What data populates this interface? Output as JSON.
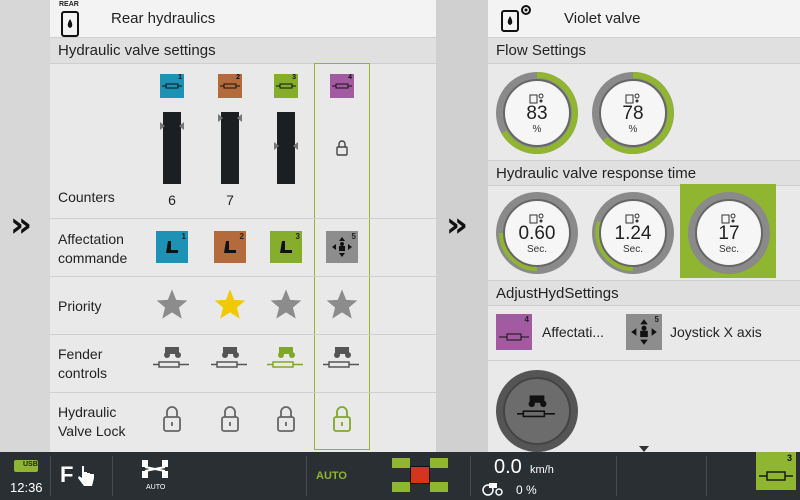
{
  "left_panel": {
    "title": "Rear hydraulics",
    "header_icon_text": "REAR",
    "section_title": "Hydraulic valve settings",
    "valves": [
      {
        "number": "1",
        "color": "#1e92b4",
        "counter": "6",
        "priority_active": false,
        "fender_active": false
      },
      {
        "number": "2",
        "color": "#b56a3c",
        "counter": "7",
        "priority_active": true,
        "fender_active": false
      },
      {
        "number": "3",
        "color": "#86ad2c",
        "counter": "",
        "priority_active": false,
        "fender_active": true
      },
      {
        "number": "4",
        "color": "#a25ba0",
        "counter": "",
        "priority_active": false,
        "fender_active": false,
        "locked": true,
        "selected": true
      }
    ],
    "rows": {
      "counters": "Counters",
      "affectation_1": "Affectation",
      "affectation_2": "commande",
      "priority": "Priority",
      "fender_1": "Fender",
      "fender_2": "controls",
      "lock_1": "Hydraulic",
      "lock_2": "Valve Lock"
    },
    "affectation_numbers": [
      "1",
      "2",
      "3",
      "5"
    ]
  },
  "right_panel": {
    "title": "Violet valve",
    "flow_title": "Flow Settings",
    "flow": [
      {
        "value": "83",
        "unit": "%",
        "level": 0.83
      },
      {
        "value": "78",
        "unit": "%",
        "level": 0.78
      }
    ],
    "response_title": "Hydraulic valve response time",
    "response": [
      {
        "value": "0.60",
        "unit": "Sec."
      },
      {
        "value": "1.24",
        "unit": "Sec."
      },
      {
        "value": "17",
        "unit": "Sec."
      }
    ],
    "adjust_title": "AdjustHydSettings",
    "affectation_label": "Affectati...",
    "joystick_label": "Joystick X axis",
    "valve_number": "4",
    "joystick_number": "5"
  },
  "bottom_bar": {
    "usb": "USB",
    "time": "12:36",
    "f_label": "F",
    "auto_small": "AUTO",
    "auto_mode": "AUTO",
    "speed": "0.0",
    "speed_unit": "km/h",
    "slip": "0 %",
    "valve_number": "3"
  },
  "colors": {
    "accent_green": "#8fb531",
    "star_active": "#f1c900",
    "star_inactive": "#8c8c8c",
    "bar_bg": "#2a2f33"
  }
}
